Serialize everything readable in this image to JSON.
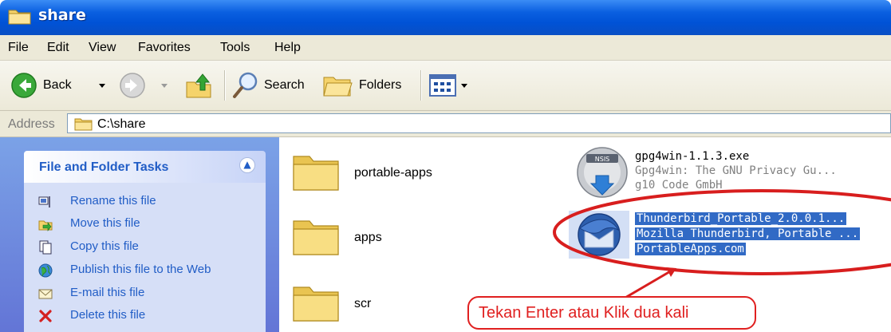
{
  "window": {
    "title": "share"
  },
  "menu": {
    "items": [
      "File",
      "Edit",
      "View",
      "Favorites",
      "Tools",
      "Help"
    ]
  },
  "toolbar": {
    "back": "Back",
    "search": "Search",
    "folders": "Folders"
  },
  "address": {
    "label": "Address",
    "path": "C:\\share"
  },
  "tasks": {
    "title": "File and Folder Tasks",
    "items": [
      "Rename this file",
      "Move this file",
      "Copy this file",
      "Publish this file to the Web",
      "E-mail this file",
      "Delete this file"
    ]
  },
  "folders": [
    "portable-apps",
    "apps",
    "scr"
  ],
  "files": [
    {
      "line1": "gpg4win-1.1.3.exe",
      "line2": "Gpg4win: The GNU Privacy Gu...",
      "line3": "g10 Code GmbH",
      "icon": "nsis-installer-icon",
      "badge": "NSIS"
    },
    {
      "line1": "Thunderbird_Portable_2.0.0.1...",
      "line2": "Mozilla Thunderbird, Portable ...",
      "line3": "PortableApps.com",
      "icon": "thunderbird-icon"
    }
  ],
  "annotation": {
    "text": "Tekan Enter atau Klik dua kali",
    "color": "#e02020"
  },
  "colors": {
    "titlebar": "#0a5fe0",
    "selection": "#316ac5",
    "task_link": "#215dc6"
  }
}
